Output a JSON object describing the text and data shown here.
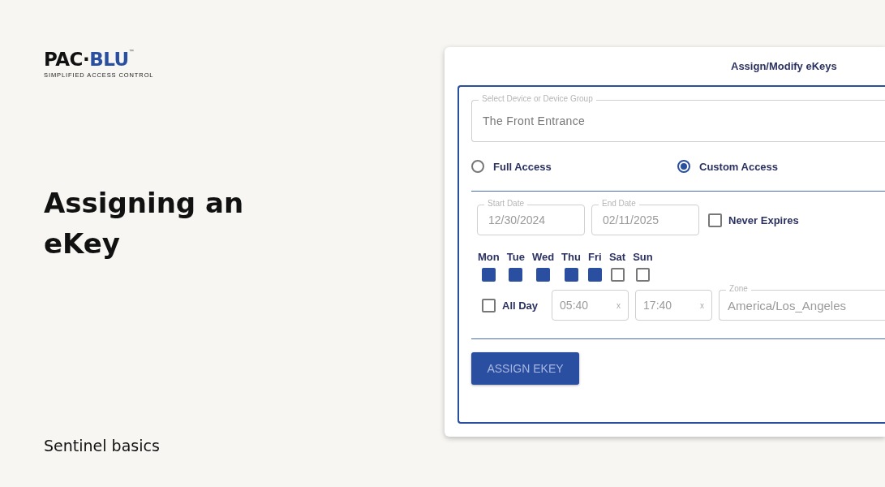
{
  "logo": {
    "dark": "PAC·",
    "blue": "BLU",
    "trademark": "™",
    "tagline": "SIMPLIFIED ACCESS CONTROL"
  },
  "heading": "Assigning an eKey",
  "footer": "Sentinel basics",
  "panel": {
    "title": "Assign/Modify eKeys",
    "device": {
      "label": "Select Device or Device Group",
      "value": "The Front Entrance"
    },
    "access": [
      {
        "label": "Full Access",
        "selected": false
      },
      {
        "label": "Custom Access",
        "selected": true
      }
    ],
    "start_date": {
      "label": "Start Date",
      "value": "12/30/2024"
    },
    "end_date": {
      "label": "End Date",
      "value": "02/11/2025"
    },
    "never_expires": {
      "label": "Never Expires",
      "checked": false
    },
    "days": [
      {
        "label": "Mon",
        "checked": true
      },
      {
        "label": "Tue",
        "checked": true
      },
      {
        "label": "Wed",
        "checked": true
      },
      {
        "label": "Thu",
        "checked": true
      },
      {
        "label": "Fri",
        "checked": true
      },
      {
        "label": "Sat",
        "checked": false
      },
      {
        "label": "Sun",
        "checked": false
      }
    ],
    "all_day": {
      "label": "All Day",
      "checked": false
    },
    "start_time": {
      "value": "05:40",
      "clear": "x"
    },
    "end_time": {
      "value": "17:40",
      "clear": "x"
    },
    "zone": {
      "label": "Zone",
      "value": "America/Los_Angeles"
    },
    "submit": "ASSIGN EKEY"
  }
}
